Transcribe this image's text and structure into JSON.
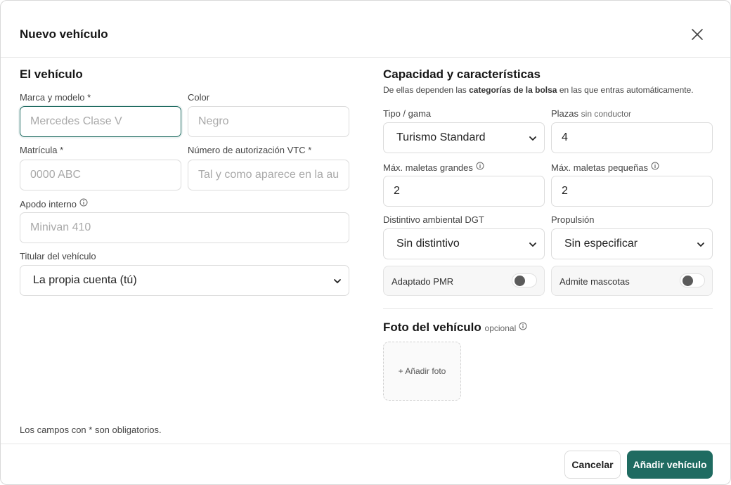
{
  "dialog": {
    "title": "Nuevo vehículo",
    "close_icon": "close-icon"
  },
  "left": {
    "section_title": "El vehículo",
    "marca_label": "Marca y modelo *",
    "marca_placeholder": "Mercedes Clase V",
    "color_label": "Color",
    "color_placeholder": "Negro",
    "matricula_label": "Matrícula *",
    "matricula_placeholder": "0000 ABC",
    "vtc_label": "Número de autorización VTC *",
    "vtc_placeholder": "Tal y como aparece en la autorización",
    "apodo_label": "Apodo interno",
    "apodo_placeholder": "Minivan 410",
    "titular_label": "Titular del vehículo",
    "titular_value": "La propia cuenta (tú)"
  },
  "right": {
    "section_title": "Capacidad y características",
    "subtitle_pre": "De ellas dependen las ",
    "subtitle_bold": "categorías de la bolsa",
    "subtitle_post": " en las que entras automáticamente.",
    "tipo_label": "Tipo / gama",
    "tipo_value": "Turismo Standard",
    "plazas_label": "Plazas",
    "plazas_muted": "sin conductor",
    "plazas_value": "4",
    "maletas_grandes_label": "Máx. maletas grandes",
    "maletas_grandes_value": "2",
    "maletas_pequenas_label": "Máx. maletas pequeñas",
    "maletas_pequenas_value": "2",
    "distintivo_label": "Distintivo ambiental DGT",
    "distintivo_value": "Sin distintivo",
    "propulsion_label": "Propulsión",
    "propulsion_value": "Sin especificar",
    "pmr_label": "Adaptado PMR",
    "pmr_on": false,
    "mascotas_label": "Admite mascotas",
    "mascotas_on": false,
    "foto_title": "Foto del vehículo",
    "foto_optional": "opcional",
    "foto_button": "+ Añadir foto"
  },
  "footer": {
    "note": "Los campos con * son obligatorios.",
    "cancel_label": "Cancelar",
    "submit_label": "Añadir vehículo"
  },
  "colors": {
    "accent": "#1f6b61",
    "border": "#dcdcdc"
  }
}
